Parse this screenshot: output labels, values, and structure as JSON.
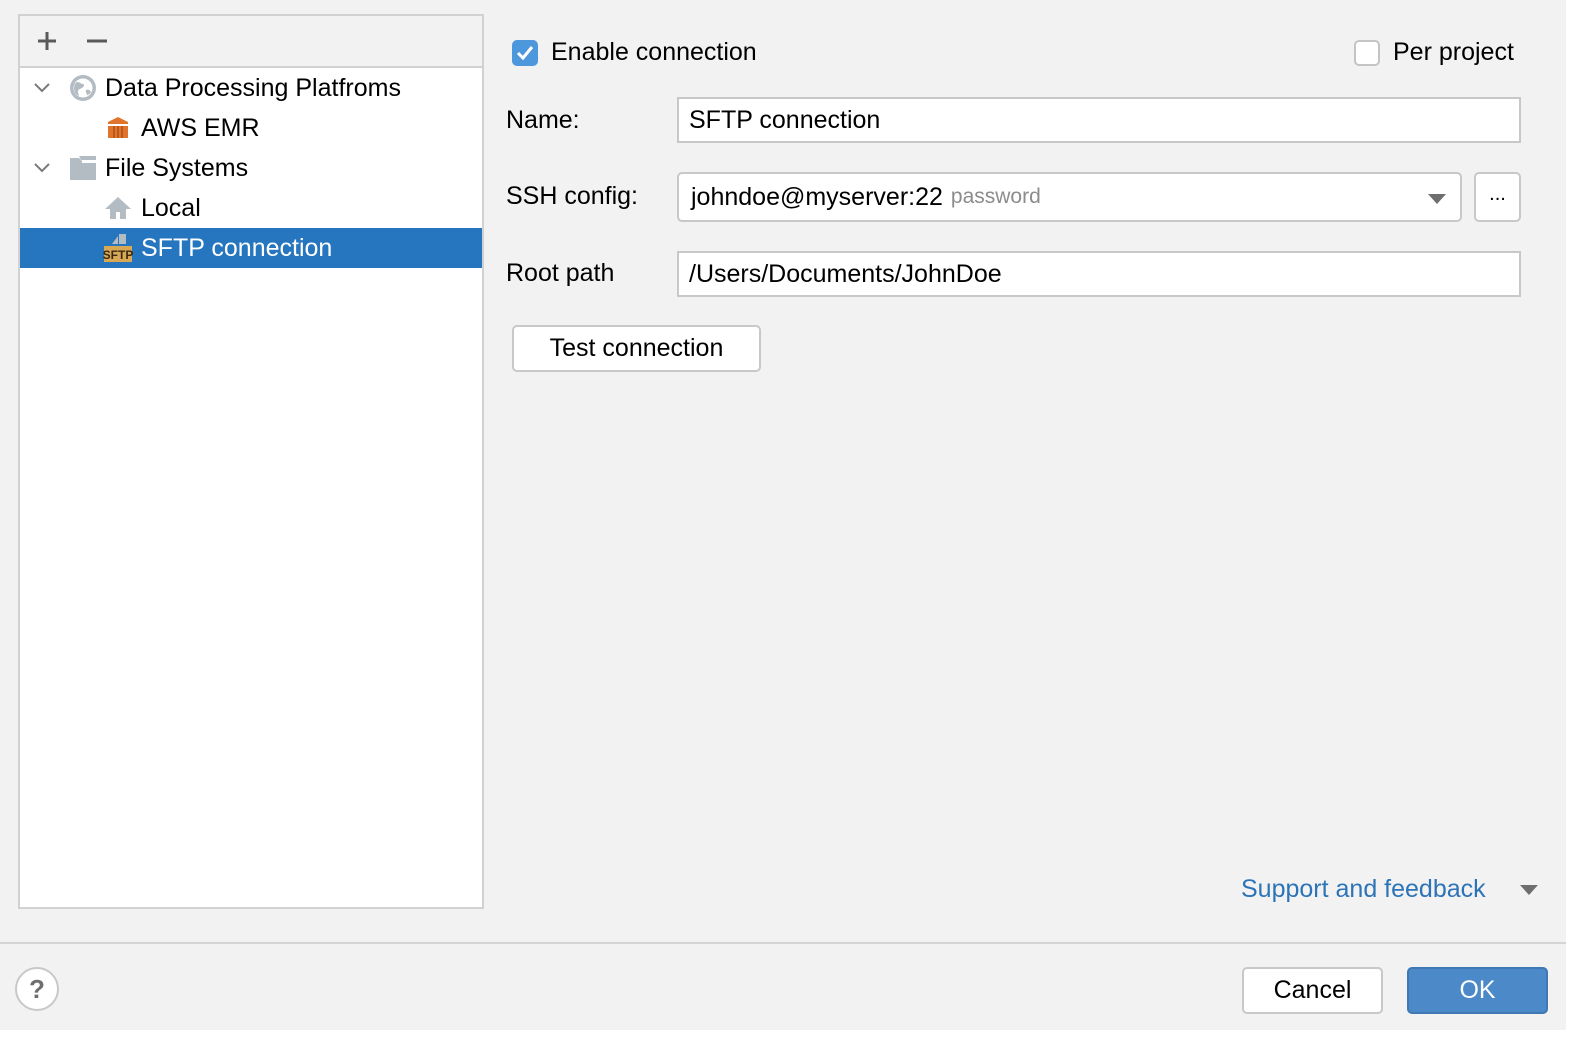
{
  "toolbar": {
    "add_icon": "plus-icon",
    "remove_icon": "minus-icon"
  },
  "tree": {
    "items": [
      {
        "label": "Data Processing Platfroms",
        "icon": "globe-icon",
        "expanded": true,
        "level": 0
      },
      {
        "label": "AWS EMR",
        "icon": "aws-emr-icon",
        "level": 1
      },
      {
        "label": "File Systems",
        "icon": "folder-icon",
        "expanded": true,
        "level": 0
      },
      {
        "label": "Local",
        "icon": "home-icon",
        "level": 1
      },
      {
        "label": "SFTP connection",
        "icon": "sftp-icon",
        "level": 1,
        "selected": true
      }
    ],
    "sftp_badge": "SFTP"
  },
  "form": {
    "enable_connection": {
      "label": "Enable connection",
      "checked": true
    },
    "per_project": {
      "label": "Per project",
      "checked": false
    },
    "name": {
      "label": "Name:",
      "value": "SFTP connection"
    },
    "ssh_config": {
      "label": "SSH config:",
      "value": "johndoe@myserver:22",
      "hint": "password",
      "browse_label": "..."
    },
    "root_path": {
      "label": "Root path",
      "value": "/Users/Documents/JohnDoe"
    },
    "test_connection_label": "Test connection"
  },
  "footer": {
    "support_link": "Support and feedback",
    "help_label": "?",
    "cancel_label": "Cancel",
    "ok_label": "OK"
  },
  "colors": {
    "selection": "#2675bf",
    "primary_button": "#4b89c8",
    "link": "#2c74b7",
    "checkbox": "#4d97dd"
  }
}
